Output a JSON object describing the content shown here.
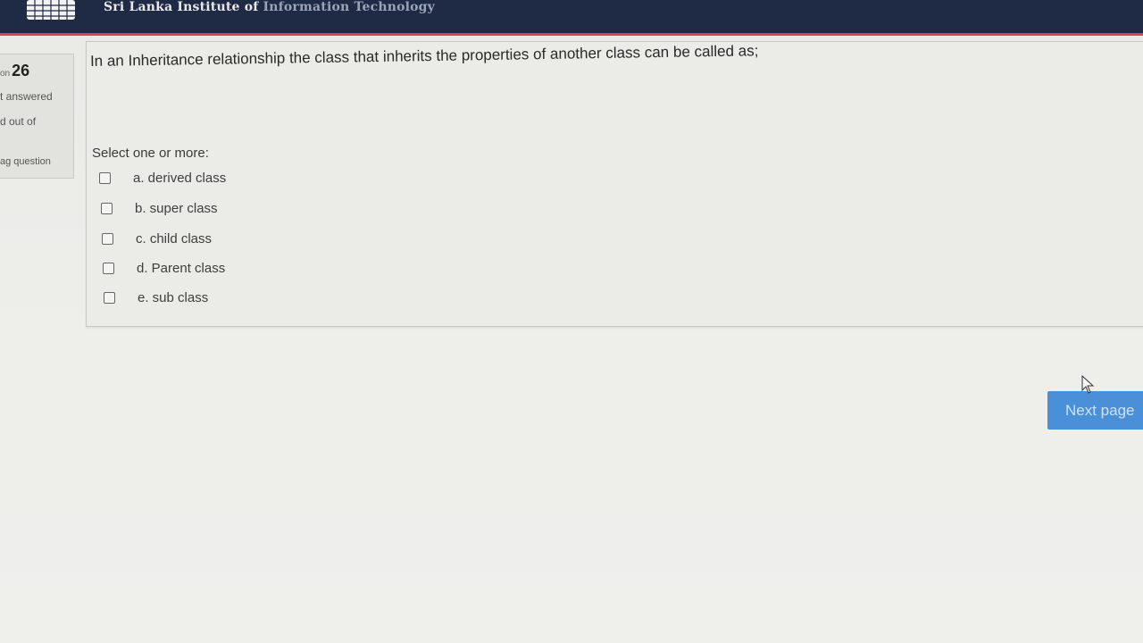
{
  "header": {
    "brand": "Sri Lanka Institute of",
    "brand_faded": "Information Technology"
  },
  "question_info": {
    "number_prefix": "on",
    "number": "26",
    "state": "t answered",
    "mark": "d out of",
    "flag": "ag question"
  },
  "question": {
    "text": "In an Inheritance relationship the class that inherits the properties of another class can be called as;",
    "prompt": "Select one or more:",
    "options": [
      {
        "label": "a. derived class",
        "checked": false
      },
      {
        "label": "b. super class",
        "checked": false
      },
      {
        "label": "c. child class",
        "checked": false
      },
      {
        "label": "d. Parent class",
        "checked": false
      },
      {
        "label": "e. sub class",
        "checked": false
      }
    ]
  },
  "navigation": {
    "next_label": "Next page"
  },
  "colors": {
    "header_bg": "#1f2a44",
    "accent_line": "#d8473d",
    "button": "#4a90d9"
  }
}
